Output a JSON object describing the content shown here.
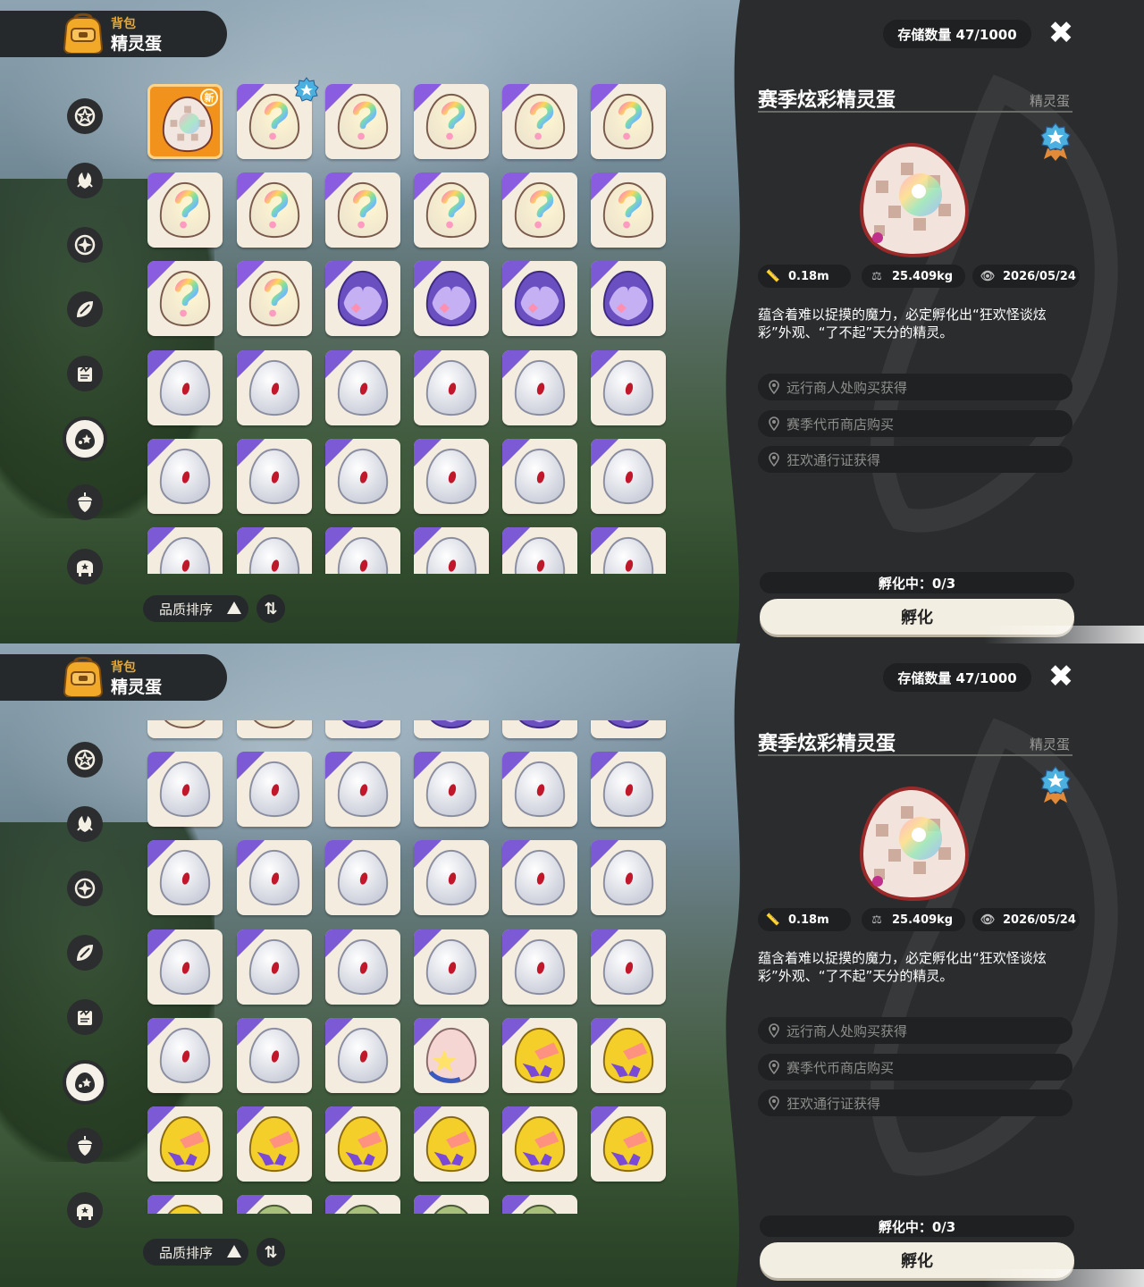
{
  "header": {
    "sub": "背包",
    "main": "精灵蛋"
  },
  "storage": "存储数量 47/1000",
  "close_label": "✖",
  "detail": {
    "title": "赛季炫彩精灵蛋",
    "type": "精灵蛋",
    "stats": {
      "size": "0.18m",
      "weight": "25.409kg",
      "date": "2026/05/24"
    },
    "description": "蕴含着难以捉摸的魔力，必定孵化出“狂欢怪谈炫彩”外观、“了不起”天分的精灵。",
    "sources": [
      "远行商人处购买获得",
      "赛季代币商店购买",
      "狂欢通行证获得"
    ],
    "hatching": "孵化中：0/3",
    "hatch_button": "孵化"
  },
  "sort": {
    "label": "品质排序",
    "swap": "⇅"
  },
  "badge_new": "新",
  "colors": {
    "panel": "#2a2c2d",
    "accent_orange": "#f0921c",
    "slot_bg": "#f3ecdf",
    "rarity_purple": "#7c5ad6"
  },
  "categories": [
    "star-badge-icon",
    "leaf-icon",
    "sparkle-icon",
    "plant-icon",
    "book-icon",
    "egg-icon",
    "acorn-icon",
    "furniture-icon"
  ],
  "active_category": 5,
  "inventory": [
    "rainbow",
    "rainbow",
    "rainbow",
    "rainbow",
    "rainbow",
    "rainbow",
    "rainbow",
    "rainbow",
    "rainbow",
    "rainbow",
    "rainbow",
    "rainbow",
    "rainbow",
    "rainbow",
    "purple",
    "purple",
    "purple",
    "purple",
    "white",
    "white",
    "white",
    "white",
    "white",
    "white",
    "white",
    "white",
    "white",
    "white",
    "white",
    "white",
    "white",
    "white",
    "white",
    "white",
    "white",
    "white",
    "white",
    "white",
    "white",
    "pink",
    "yellow",
    "yellow",
    "yellow",
    "yellow",
    "yellow",
    "yellow",
    "yellow",
    "yellow",
    "yellow",
    "green",
    "green",
    "green",
    "green"
  ]
}
